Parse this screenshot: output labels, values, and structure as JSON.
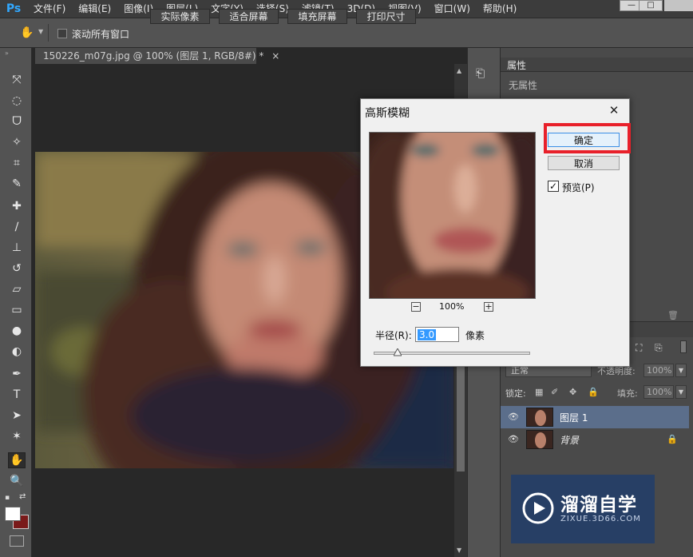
{
  "app": {
    "logo": "Ps"
  },
  "menubar": {
    "items": [
      "文件(F)",
      "编辑(E)",
      "图像(I)",
      "图层(L)",
      "文字(Y)",
      "选择(S)",
      "滤镜(T)",
      "3D(D)",
      "视图(V)",
      "窗口(W)",
      "帮助(H)"
    ],
    "window_controls": {
      "minimize": "—",
      "maximize": "□"
    }
  },
  "options_bar": {
    "scroll_all_label": "滚动所有窗口",
    "buttons": [
      "实际像素",
      "适合屏幕",
      "填充屏幕",
      "打印尺寸"
    ]
  },
  "document": {
    "tab_title": "150226_m07g.jpg @ 100% (图层 1, RGB/8#) *",
    "tab_close": "×"
  },
  "properties_panel": {
    "tab_label": "属性",
    "empty_text": "无属性"
  },
  "layers_panel": {
    "blend_mode": "正常",
    "opacity_label": "不透明度:",
    "opacity_value": "100%",
    "lock_label": "锁定:",
    "fill_label": "填充:",
    "fill_value": "100%",
    "layers": [
      {
        "name": "图层 1",
        "selected": true
      },
      {
        "name": "背景",
        "locked": true
      }
    ]
  },
  "dialog": {
    "title": "高斯模糊",
    "close_glyph": "✕",
    "ok_label": "确定",
    "cancel_label": "取消",
    "preview_label": "预览(P)",
    "preview_checked": true,
    "zoom_out": "−",
    "zoom_in": "+",
    "zoom_value": "100%",
    "radius_label": "半径(R):",
    "radius_value": "3.0",
    "radius_unit": "像素"
  },
  "watermark": {
    "brand": "溜溜自学",
    "url": "ZIXUE.3D66.COM"
  },
  "colors": {
    "highlight": "#e8202a",
    "ps_blue": "#31a8ff",
    "selected_layer": "#5b6e8b"
  }
}
